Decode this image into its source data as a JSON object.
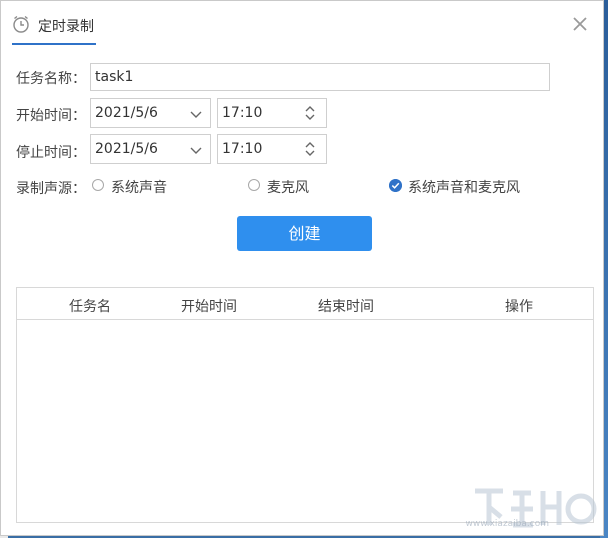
{
  "window": {
    "title": "定时录制"
  },
  "form": {
    "task_name_label": "任务名称：",
    "task_name_value": "task1",
    "start_label": "开始时间：",
    "start_date": "2021/5/6",
    "start_time": "17:10",
    "stop_label": "停止时间：",
    "stop_date": "2021/5/6",
    "stop_time": "17:10",
    "source_label": "录制声源：",
    "sources": [
      {
        "label": "系统声音",
        "checked": false
      },
      {
        "label": "麦克风",
        "checked": false
      },
      {
        "label": "系统声音和麦克风",
        "checked": true
      }
    ],
    "create_label": "创建"
  },
  "table": {
    "headers": [
      "任务名",
      "开始时间",
      "结束时间",
      "操作"
    ],
    "rows": []
  },
  "watermark": {
    "url": "www.xiazaiba.com"
  },
  "colors": {
    "accent": "#2f72c8",
    "button": "#2f8fee"
  }
}
